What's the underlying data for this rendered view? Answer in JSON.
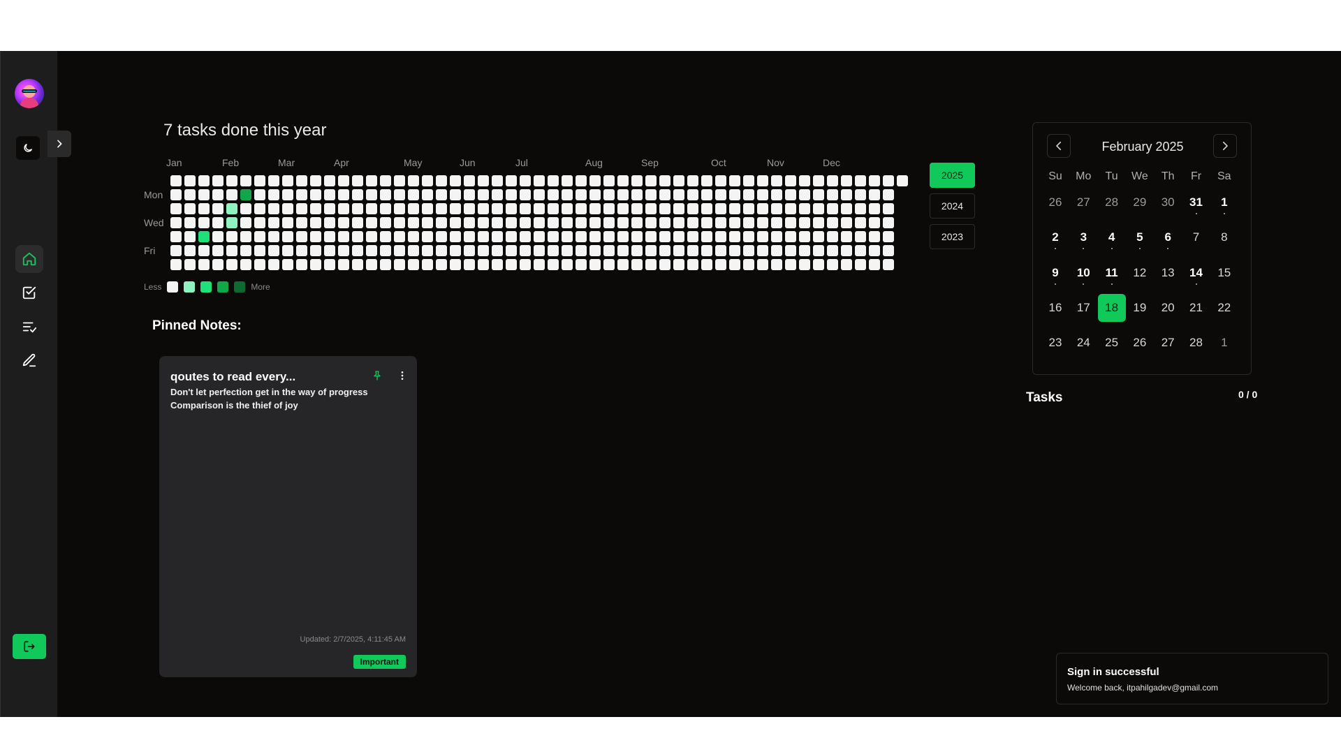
{
  "colors": {
    "accent": "#10c95a",
    "background": "#0b0a09",
    "sidebar": "#1d1d1e",
    "card": "#262628"
  },
  "sidebar": {
    "avatar": "user-avatar",
    "theme_icon": "moon-icon",
    "expand_icon": "chevron-right-icon",
    "nav": [
      {
        "id": "home",
        "icon": "home-icon",
        "active": true
      },
      {
        "id": "tasks",
        "icon": "checkbox-icon",
        "active": false
      },
      {
        "id": "lists",
        "icon": "list-check-icon",
        "active": false
      },
      {
        "id": "notes",
        "icon": "pen-icon",
        "active": false
      }
    ],
    "logout_icon": "logout-icon"
  },
  "heatmap": {
    "title": "7 tasks done this year",
    "months": [
      "Jan",
      "Feb",
      "Mar",
      "Apr",
      "May",
      "Jun",
      "Jul",
      "Aug",
      "Sep",
      "Oct",
      "Nov",
      "Dec"
    ],
    "day_labels": [
      "Mon",
      "Wed",
      "Fri"
    ],
    "legend": {
      "less": "Less",
      "more": "More",
      "levels": [
        "#f4f4f4",
        "#8ff2c1",
        "#1ee07a",
        "#10a74a",
        "#0b6b31"
      ]
    },
    "activity": [
      {
        "week": 5,
        "day": 1,
        "level": 3
      },
      {
        "week": 4,
        "day": 2,
        "level": 1
      },
      {
        "week": 4,
        "day": 3,
        "level": 1
      },
      {
        "week": 2,
        "day": 4,
        "level": 2
      }
    ],
    "years": [
      {
        "label": "2025",
        "active": true
      },
      {
        "label": "2024",
        "active": false
      },
      {
        "label": "2023",
        "active": false
      }
    ]
  },
  "pinned": {
    "title": "Pinned Notes:",
    "notes": [
      {
        "title": "qoutes to read every...",
        "lines": [
          "Don't let perfection get in the way of progress",
          "Comparison is the thief of joy"
        ],
        "updated": "Updated: 2/7/2025, 4:11:45 AM",
        "tag": "Important",
        "pin_icon": "pin-icon",
        "menu_icon": "more-vertical-icon"
      }
    ]
  },
  "calendar": {
    "title": "February 2025",
    "weekdays": [
      "Su",
      "Mo",
      "Tu",
      "We",
      "Th",
      "Fr",
      "Sa"
    ],
    "weeks": [
      [
        {
          "d": "26",
          "o": true
        },
        {
          "d": "27",
          "o": true
        },
        {
          "d": "28",
          "o": true
        },
        {
          "d": "29",
          "o": true
        },
        {
          "d": "30",
          "o": true
        },
        {
          "d": "31",
          "o": true,
          "b": true,
          "dot": true
        },
        {
          "d": "1",
          "b": true,
          "dot": true
        }
      ],
      [
        {
          "d": "2",
          "b": true,
          "dot": true
        },
        {
          "d": "3",
          "b": true,
          "dot": true
        },
        {
          "d": "4",
          "b": true,
          "dot": true
        },
        {
          "d": "5",
          "b": true,
          "dot": true
        },
        {
          "d": "6",
          "b": true,
          "dot": true
        },
        {
          "d": "7"
        },
        {
          "d": "8"
        }
      ],
      [
        {
          "d": "9",
          "b": true,
          "dot": true
        },
        {
          "d": "10",
          "b": true,
          "dot": true
        },
        {
          "d": "11",
          "b": true,
          "dot": true
        },
        {
          "d": "12"
        },
        {
          "d": "13"
        },
        {
          "d": "14",
          "b": true,
          "dot": true
        },
        {
          "d": "15"
        }
      ],
      [
        {
          "d": "16"
        },
        {
          "d": "17"
        },
        {
          "d": "18",
          "today": true
        },
        {
          "d": "19"
        },
        {
          "d": "20"
        },
        {
          "d": "21"
        },
        {
          "d": "22"
        }
      ],
      [
        {
          "d": "23"
        },
        {
          "d": "24"
        },
        {
          "d": "25"
        },
        {
          "d": "26"
        },
        {
          "d": "27"
        },
        {
          "d": "28"
        },
        {
          "d": "1",
          "o": true
        }
      ]
    ]
  },
  "tasks": {
    "title": "Tasks",
    "count": "0 / 0"
  },
  "toast": {
    "title": "Sign in successful",
    "message": "Welcome back, itpahilgadev@gmail.com"
  }
}
